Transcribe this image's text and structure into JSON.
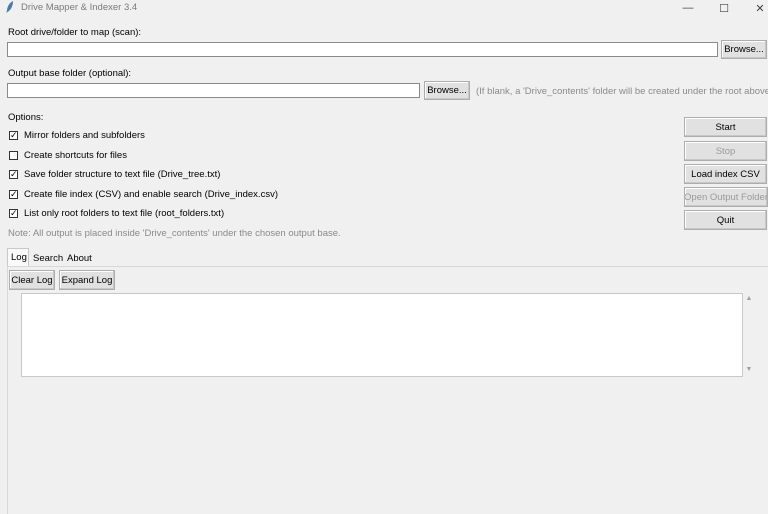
{
  "window": {
    "title": "Drive Mapper & Indexer 3.4",
    "minimize_glyph": "—",
    "maximize_glyph": "☐",
    "close_glyph": "✕"
  },
  "root": {
    "label": "Root drive/folder to map (scan):",
    "value": "",
    "browse_label": "Browse..."
  },
  "output": {
    "label": "Output base folder (optional):",
    "value": "",
    "browse_label": "Browse...",
    "hint": "(If blank, a 'Drive_contents' folder will be created under the root above.)"
  },
  "options": {
    "heading": "Options:",
    "items": [
      {
        "label": "Mirror folders and subfolders",
        "checked": true,
        "mark": "✓"
      },
      {
        "label": "Create shortcuts for files",
        "checked": false,
        "mark": ""
      },
      {
        "label": "Save folder structure to text file (Drive_tree.txt)",
        "checked": true,
        "mark": "✓"
      },
      {
        "label": "Create file index (CSV) and enable search (Drive_index.csv)",
        "checked": true,
        "mark": "✓"
      },
      {
        "label": "List only root folders to text file (root_folders.txt)",
        "checked": true,
        "mark": "✓"
      }
    ],
    "note": "Note: All output is placed inside 'Drive_contents' under the chosen output base."
  },
  "actions": {
    "start": "Start",
    "stop": "Stop",
    "load_index": "Load index CSV",
    "open_output": "Open Output Folder",
    "quit": "Quit"
  },
  "tabs": [
    {
      "label": "Log",
      "active": true
    },
    {
      "label": "Search",
      "active": false
    },
    {
      "label": "About",
      "active": false
    }
  ],
  "log": {
    "clear_label": "Clear Log",
    "expand_label": "Expand Log",
    "content": ""
  },
  "icons": {
    "app": "feather-icon",
    "scroll_up": "▲",
    "scroll_down": "▼"
  }
}
